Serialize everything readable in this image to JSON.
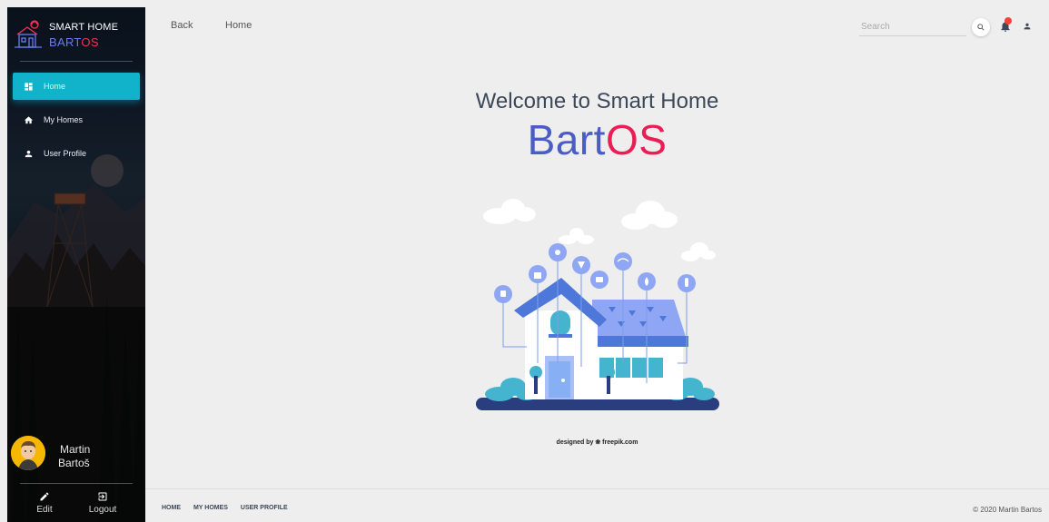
{
  "sidebar": {
    "brand": {
      "line1": "SMART HOME",
      "line2_main": "BART",
      "line2_accent": "OS"
    },
    "items": [
      {
        "label": "Home",
        "icon": "dashboard-icon",
        "active": true
      },
      {
        "label": "My Homes",
        "icon": "home-icon",
        "active": false
      },
      {
        "label": "User Profile",
        "icon": "person-icon",
        "active": false
      }
    ],
    "user": {
      "first_name": "Martin",
      "last_name": "Bartoš"
    },
    "actions": {
      "edit": "Edit",
      "logout": "Logout"
    }
  },
  "topbar": {
    "back_label": "Back",
    "home_label": "Home",
    "search_placeholder": "Search"
  },
  "main": {
    "welcome": "Welcome to Smart Home",
    "title_main": "Bart",
    "title_accent": "OS",
    "credit": "designed by ❀ freepik.com"
  },
  "footer": {
    "links": [
      "HOME",
      "MY HOMES",
      "USER PROFILE"
    ],
    "copyright": "© 2020 Martin Bartos"
  },
  "colors": {
    "accent": "#10b3c9",
    "brand_blue": "#4b5cc4",
    "brand_pink": "#ec1c54",
    "notification": "#f44336"
  }
}
